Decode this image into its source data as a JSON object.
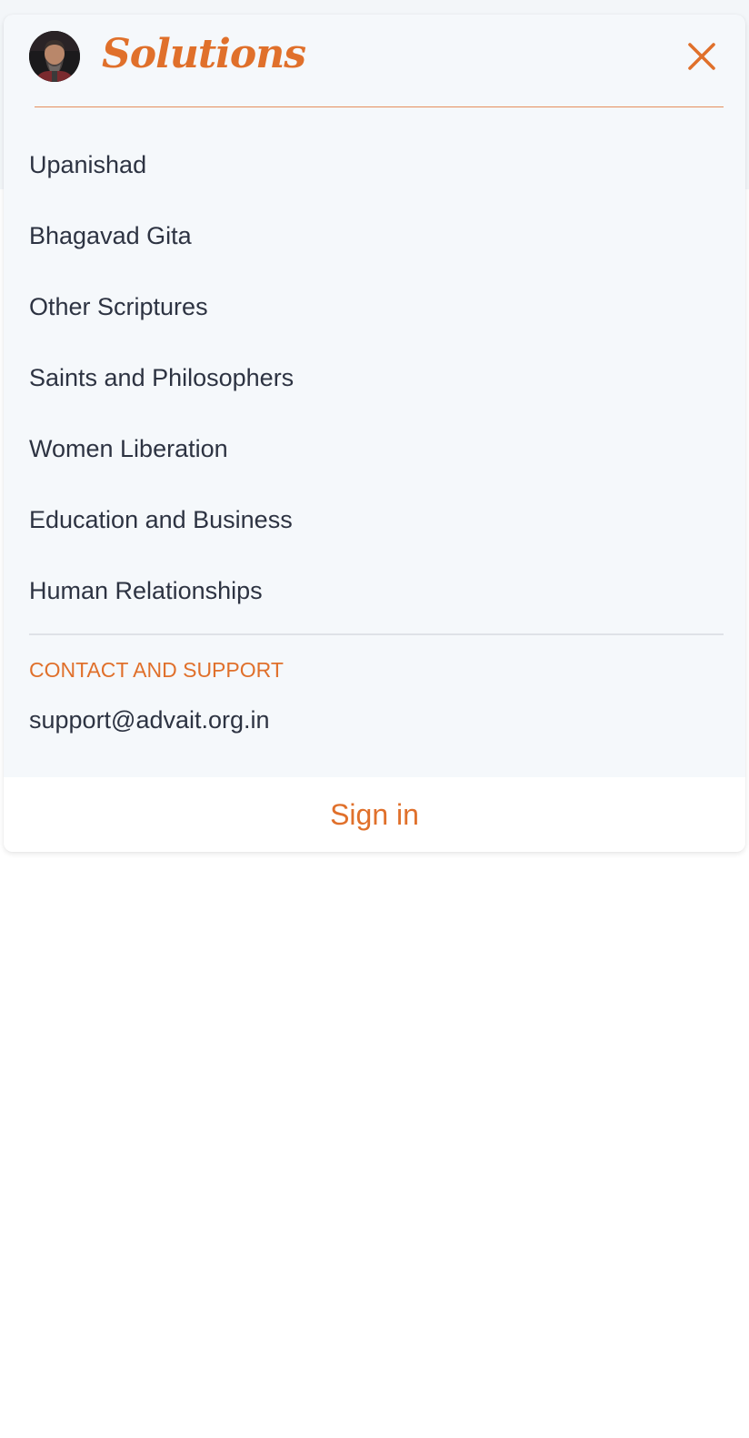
{
  "header": {
    "brand_title": "Solutions",
    "avatar_icon": "person-portrait-avatar",
    "close_icon": "close-icon"
  },
  "nav": {
    "items": [
      {
        "label": "Upanishad"
      },
      {
        "label": "Bhagavad Gita"
      },
      {
        "label": "Other Scriptures"
      },
      {
        "label": "Saints and Philosophers"
      },
      {
        "label": "Women Liberation"
      },
      {
        "label": "Education and Business"
      },
      {
        "label": "Human Relationships"
      }
    ]
  },
  "contact": {
    "heading": "CONTACT AND SUPPORT",
    "email": "support@advait.org.in"
  },
  "footer": {
    "signin_label": "Sign in"
  },
  "colors": {
    "accent": "#e0702b",
    "text": "#2d3342",
    "panel_bg": "#f5f8fb",
    "divider": "#dfe2e7"
  }
}
